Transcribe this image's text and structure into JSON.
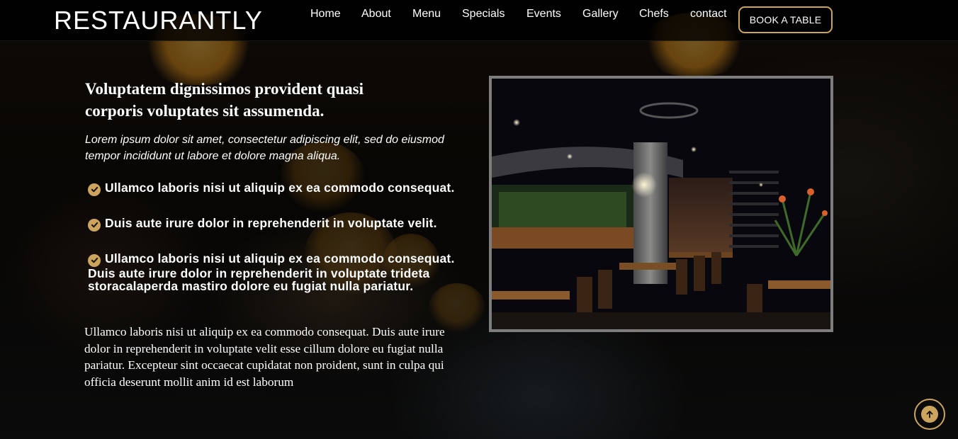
{
  "brand": {
    "name": "RESTAURANTLY"
  },
  "nav": {
    "items": [
      {
        "label": "Home"
      },
      {
        "label": "About"
      },
      {
        "label": "Menu"
      },
      {
        "label": "Specials"
      },
      {
        "label": "Events"
      },
      {
        "label": "Gallery"
      },
      {
        "label": "Chefs"
      },
      {
        "label": "contact"
      }
    ],
    "cta_label": "BOOK A TABLE"
  },
  "about": {
    "heading": "Voluptatem dignissimos provident quasi corporis voluptates sit assumenda.",
    "intro": "Lorem ipsum dolor sit amet, consectetur adipiscing elit, sed do eiusmod tempor incididunt ut labore et dolore magna aliqua.",
    "features": [
      "Ullamco laboris nisi ut aliquip ex ea commodo consequat.",
      "Duis aute irure dolor in reprehenderit in voluptate velit.",
      "Ullamco laboris nisi ut aliquip ex ea commodo consequat. Duis aute irure dolor in reprehenderit in voluptate trideta storacalaperda mastiro dolore eu fugiat nulla pariatur."
    ],
    "paragraph": "Ullamco laboris nisi ut aliquip ex ea commodo consequat. Duis aute irure dolor in reprehenderit in voluptate velit esse cillum dolore eu fugiat nulla pariatur. Excepteur sint occaecat cupidatat non proident, sunt in culpa qui officia deserunt mollit anim id est laborum"
  },
  "icons": {
    "feature_bullet": "check-circle-icon",
    "back_to_top": "arrow-up-circle-icon"
  },
  "colors": {
    "accent": "#cda45e",
    "header_bg": "#000000",
    "frame_border": "#7d7d7d"
  }
}
